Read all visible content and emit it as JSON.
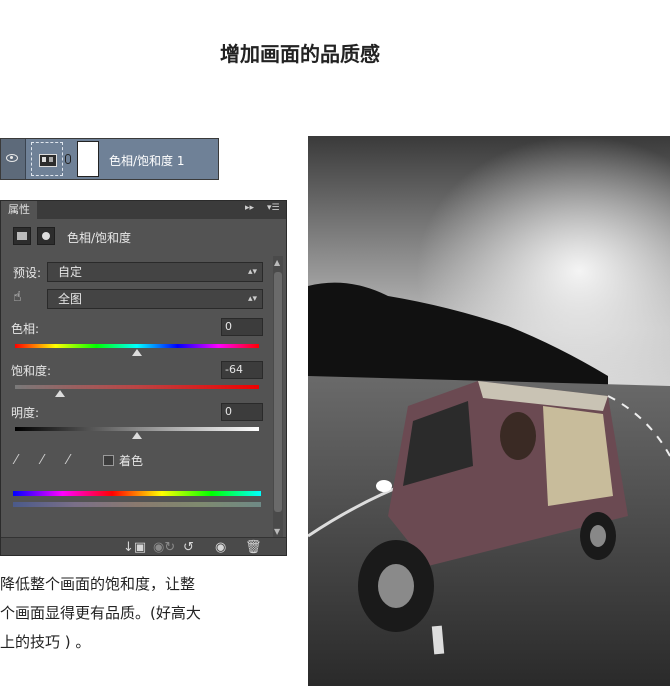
{
  "title": "增加画面的品质感",
  "layer": {
    "name": "色相/饱和度 1"
  },
  "panel": {
    "tab": "属性",
    "adjustment_label": "色相/饱和度",
    "preset_label": "预设:",
    "preset_value": "自定",
    "channel_value": "全图",
    "hue": {
      "label": "色相:",
      "value": "0",
      "level": 0
    },
    "saturation": {
      "label": "饱和度:",
      "value": "-64",
      "level": -64
    },
    "lightness": {
      "label": "明度:",
      "value": "0",
      "level": 0
    },
    "colorize_label": "着色"
  },
  "caption": {
    "line1": "降低整个画面的饱和度，让整",
    "line2": "个画面显得更有品质。(好高大",
    "line3": "上的技巧 ) 。"
  }
}
